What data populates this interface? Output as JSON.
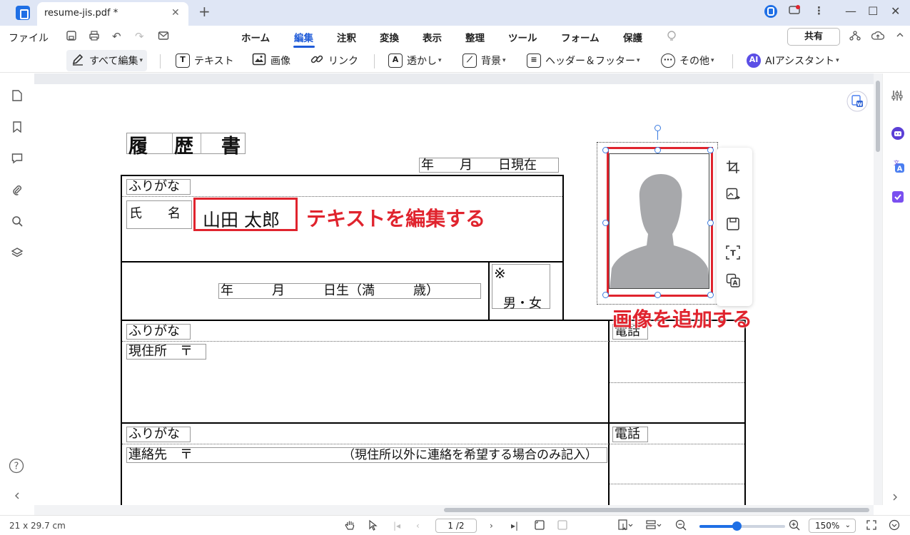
{
  "window": {
    "tab_title": "resume-jis.pdf *",
    "tab_close": "✕",
    "new_tab": "+",
    "minimize": "—",
    "maximize": "☐",
    "close": "✕"
  },
  "menubar": {
    "file": "ファイル",
    "tabs": [
      "ホーム",
      "編集",
      "注釈",
      "変換",
      "表示",
      "整理",
      "ツール",
      "フォーム",
      "保護"
    ],
    "active_tab": "編集",
    "share": "共有"
  },
  "toolbar": {
    "edit_all": "すべて編集",
    "text": "テキスト",
    "image": "画像",
    "link": "リンク",
    "watermark": "透かし",
    "background": "背景",
    "header_footer": "ヘッダー＆フッター",
    "more": "その他",
    "ai_assistant": "AIアシスタント",
    "ai_badge": "AI"
  },
  "resume": {
    "title_chars": [
      "履",
      "歴",
      "書"
    ],
    "date_line": "年　　月　　日現在",
    "furigana": "ふりがな",
    "name_label": "氏　　名",
    "name_value": "山田 太郎",
    "birth_line": "年　　　月　　　日生（満　　　歳）",
    "note_mark": "※",
    "gender": "男・女",
    "address_label": "現住所　〒",
    "phone": "電話",
    "contact_label": "連絡先　〒",
    "contact_note": "（現住所以外に連絡を希望する場合のみ記入）"
  },
  "annotations": {
    "edit_text": "テキストを編集する",
    "add_image": "画像を追加する"
  },
  "statusbar": {
    "page_size": "21 x 29.7 cm",
    "page_indicator": "1 /2",
    "zoom": "150%"
  },
  "colors": {
    "accent": "#1f5bd8",
    "annotation_red": "#e0242e",
    "silhouette": "#a7a8ab"
  }
}
